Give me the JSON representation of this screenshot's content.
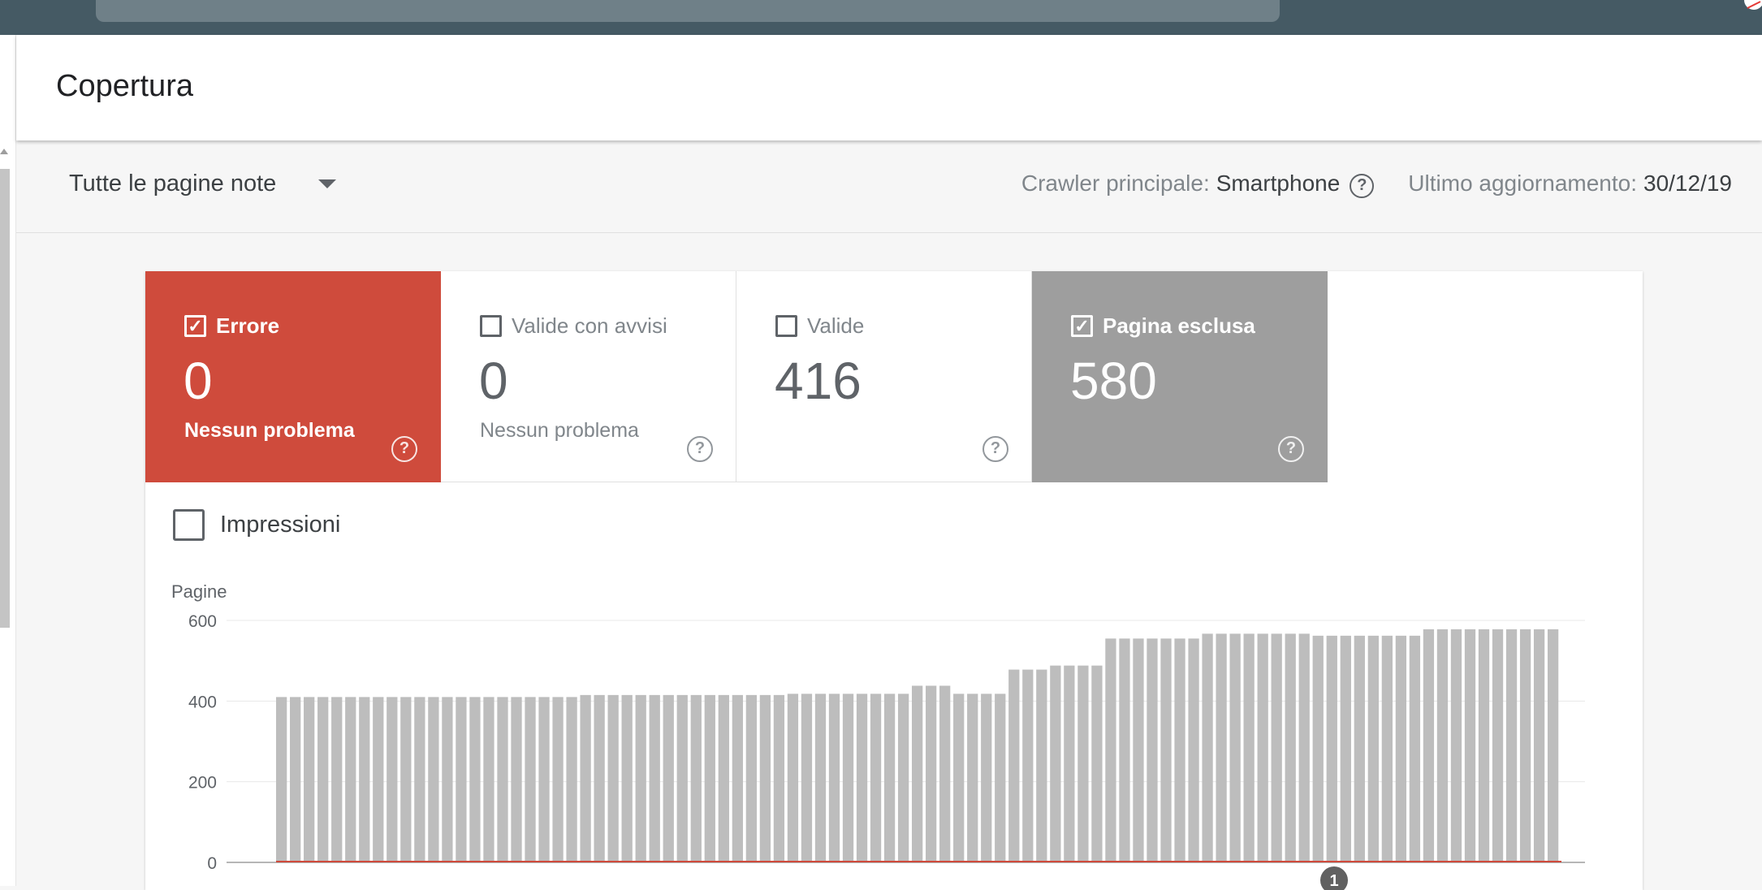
{
  "header": {
    "title": "Copertura"
  },
  "filter": {
    "selected": "Tutte le pagine note",
    "crawler_label": "Crawler principale:",
    "crawler_value": "Smartphone",
    "updated_label": "Ultimo aggiornamento:",
    "updated_value": "30/12/19"
  },
  "tiles": [
    {
      "label": "Errore",
      "count": "0",
      "sub": "Nessun problema",
      "checked": true
    },
    {
      "label": "Valide con avvisi",
      "count": "0",
      "sub": "Nessun problema",
      "checked": false
    },
    {
      "label": "Valide",
      "count": "416",
      "sub": "",
      "checked": false
    },
    {
      "label": "Pagina esclusa",
      "count": "580",
      "sub": "",
      "checked": true
    }
  ],
  "impressions_label": "Impressioni",
  "colors": {
    "error": "#cf4b3c",
    "excluded": "#9e9e9e",
    "bar": "#bdbdbd",
    "topbar": "#455a64"
  },
  "chart_data": {
    "type": "bar",
    "ylabel": "Pagine",
    "ylim": [
      0,
      600
    ],
    "yticks": [
      "600",
      "400",
      "200",
      "0"
    ],
    "series": [
      {
        "name": "Pagina esclusa",
        "values": [
          410,
          410,
          410,
          410,
          410,
          410,
          410,
          410,
          410,
          410,
          410,
          410,
          410,
          410,
          410,
          410,
          410,
          410,
          410,
          410,
          410,
          410,
          415,
          415,
          415,
          415,
          415,
          415,
          415,
          415,
          415,
          415,
          415,
          415,
          415,
          415,
          415,
          418,
          418,
          418,
          418,
          418,
          418,
          418,
          418,
          418,
          438,
          438,
          438,
          418,
          418,
          418,
          418,
          478,
          478,
          478,
          488,
          488,
          488,
          488,
          555,
          555,
          555,
          555,
          555,
          555,
          555,
          567,
          567,
          567,
          567,
          567,
          567,
          567,
          567,
          562,
          562,
          562,
          562,
          562,
          562,
          562,
          562,
          578,
          578,
          578,
          578,
          578,
          578,
          578,
          578,
          578,
          578
        ]
      },
      {
        "name": "Errore",
        "values": [
          0,
          0,
          0,
          0,
          0,
          0,
          0,
          0,
          0,
          0,
          0,
          0,
          0,
          0,
          0,
          0,
          0,
          0,
          0,
          0,
          0,
          0,
          0,
          0,
          0,
          0,
          0,
          0,
          0,
          0,
          0,
          0,
          0,
          0,
          0,
          0,
          0,
          0,
          0,
          0,
          0,
          0,
          0,
          0,
          0,
          0,
          0,
          0,
          0,
          0,
          0,
          0,
          0,
          0,
          0,
          0,
          0,
          0,
          0,
          0,
          0,
          0,
          0,
          0,
          0,
          0,
          0,
          0,
          0,
          0,
          0,
          0,
          0,
          0,
          0,
          0,
          0,
          0,
          0,
          0,
          0,
          0,
          0,
          0,
          0,
          0,
          0,
          0,
          0,
          0,
          0,
          0,
          0
        ]
      }
    ],
    "annotation": "1"
  }
}
